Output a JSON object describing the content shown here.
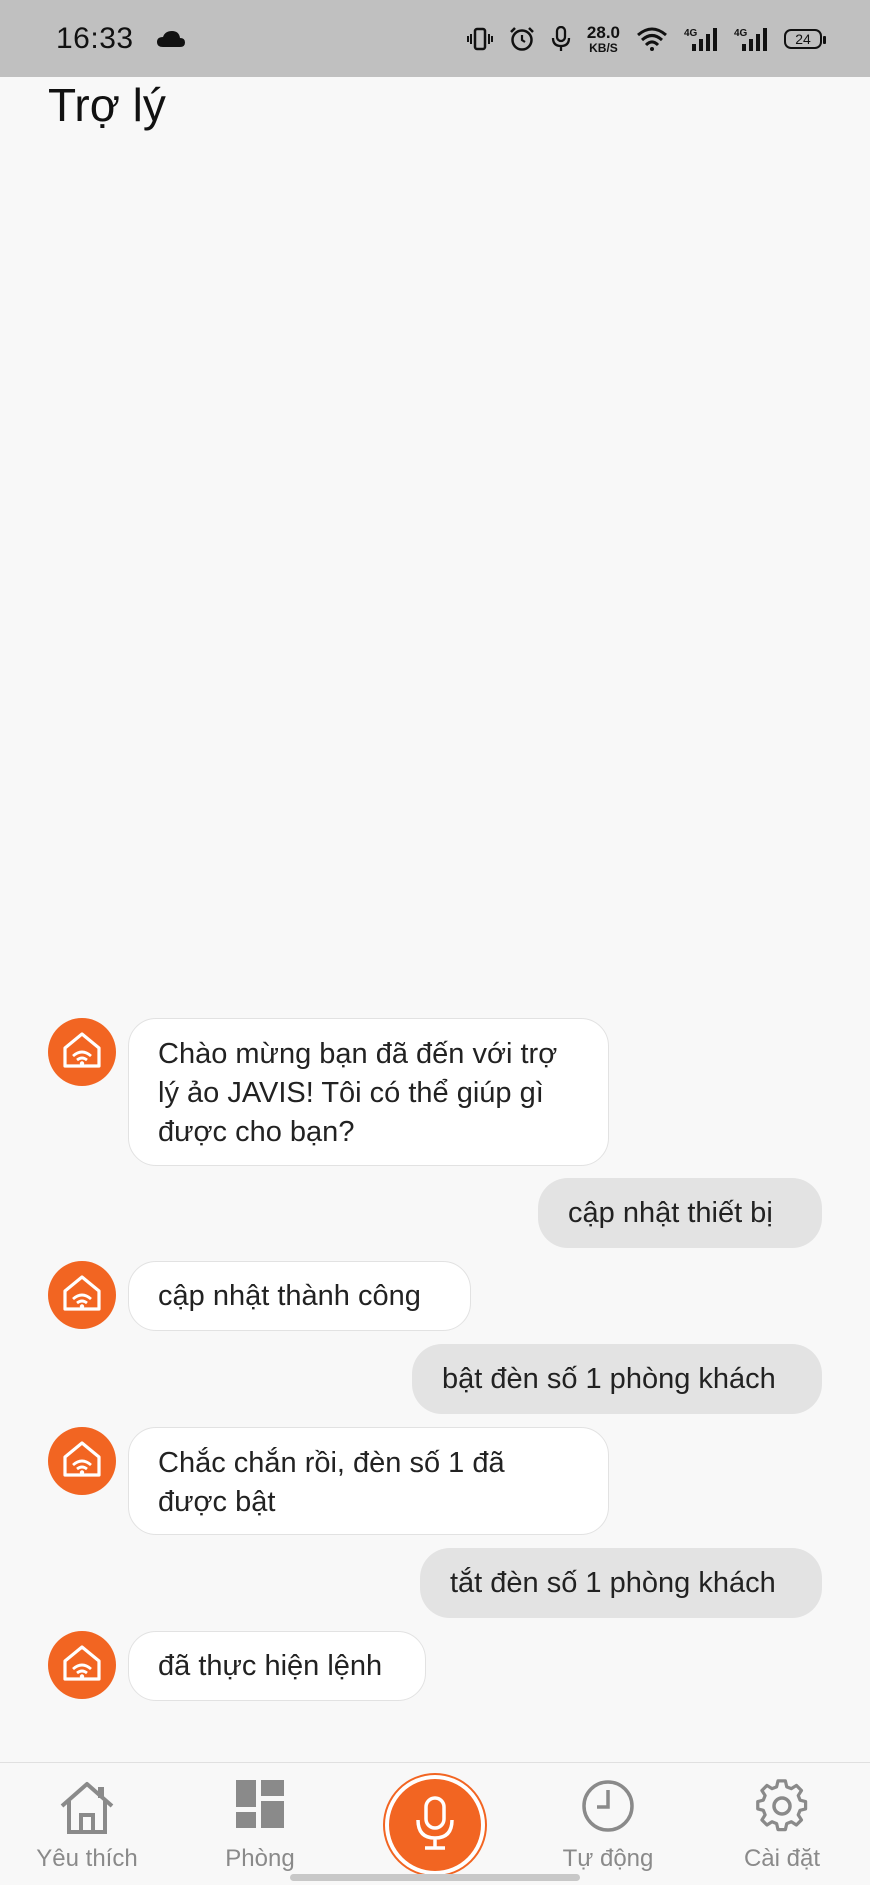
{
  "status_bar": {
    "time": "16:33",
    "net_speed_value": "28.0",
    "net_speed_unit": "KB/S",
    "signal_1_label": "4G",
    "signal_2_label": "4G",
    "battery": "24",
    "icons": [
      "cloud-icon",
      "vibrate-icon",
      "alarm-icon",
      "microphone-icon",
      "wifi-icon",
      "signal-icon",
      "signal-icon",
      "battery-icon"
    ]
  },
  "header": {
    "title": "Trợ lý"
  },
  "chat": {
    "messages": [
      {
        "sender": "bot",
        "text": "Chào mừng bạn đã đến với trợ lý ảo JAVIS! Tôi có thể giúp gì được cho bạn?"
      },
      {
        "sender": "user",
        "text": "cập nhật thiết bị"
      },
      {
        "sender": "bot",
        "text": "cập nhật thành công"
      },
      {
        "sender": "user",
        "text": "bật đèn số 1 phòng khách"
      },
      {
        "sender": "bot",
        "text": "Chắc chắn rồi, đèn số 1 đã được bật"
      },
      {
        "sender": "user",
        "text": "tắt đèn số 1 phòng khách"
      },
      {
        "sender": "bot",
        "text": "đã thực hiện lệnh"
      }
    ],
    "bot_avatar_icon": "smart-home-icon"
  },
  "bottom_nav": {
    "items": [
      {
        "label": "Yêu thích",
        "icon": "home-icon"
      },
      {
        "label": "Phòng",
        "icon": "grid-icon"
      },
      {
        "label": "",
        "icon": "microphone-icon"
      },
      {
        "label": "Tự động",
        "icon": "clock-icon"
      },
      {
        "label": "Cài đặt",
        "icon": "gear-icon"
      }
    ]
  },
  "colors": {
    "accent": "#f26522",
    "background": "#f8f8f8",
    "status_bar": "#c0c0c0",
    "bot_bubble": "#ffffff",
    "user_bubble": "#e3e3e3",
    "nav_label": "#8a8a8a"
  }
}
